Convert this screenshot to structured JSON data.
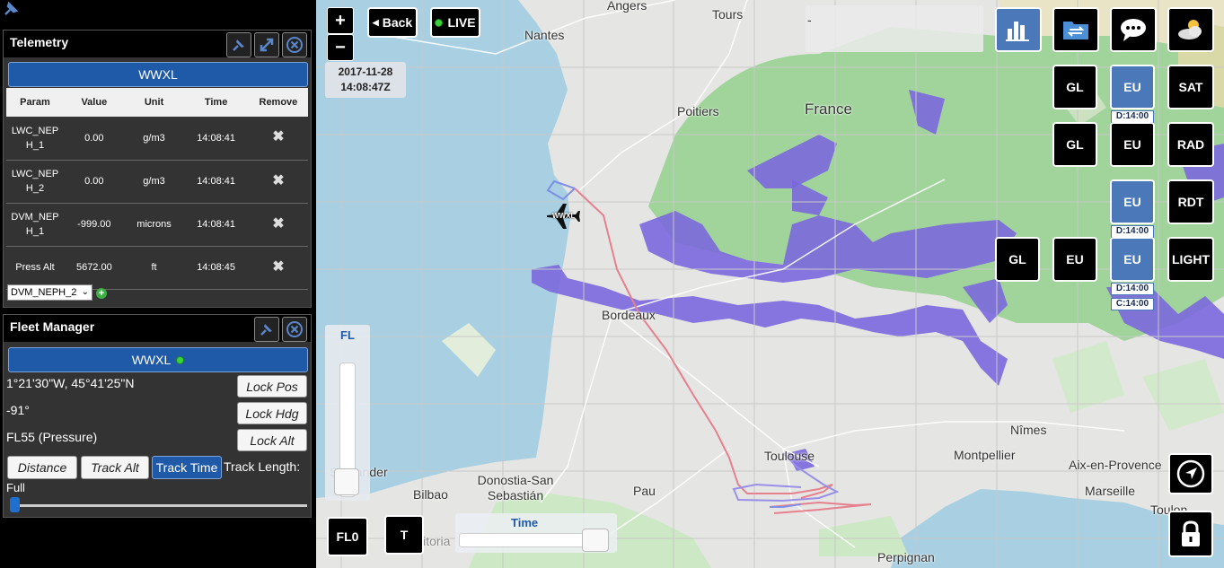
{
  "telemetry": {
    "title": "Telemetry",
    "registration": "WWXL",
    "columns": [
      "Param",
      "Value",
      "Unit",
      "Time",
      "Remove"
    ],
    "rows": [
      {
        "param": "LWC_NEPH_1",
        "value": "0.00",
        "unit": "g/m3",
        "time": "14:08:41",
        "remove": "✖"
      },
      {
        "param": "LWC_NEPH_2",
        "value": "0.00",
        "unit": "g/m3",
        "time": "14:08:41",
        "remove": "✖"
      },
      {
        "param": "DVM_NEPH_1",
        "value": "-999.00",
        "unit": "microns",
        "time": "14:08:41",
        "remove": "✖"
      },
      {
        "param": "Press Alt",
        "value": "5672.00",
        "unit": "ft",
        "time": "14:08:45",
        "remove": "✖"
      }
    ],
    "select_value": "DVM_NEPH_2"
  },
  "fleet": {
    "title": "Fleet Manager",
    "registration": "WWXL",
    "position": "1°21'30\"W, 45°41'25\"N",
    "heading": "-91°",
    "altitude": "FL55 (Pressure)",
    "lock_pos": "Lock Pos",
    "lock_hdg": "Lock Hdg",
    "lock_alt": "Lock Alt",
    "btn_distance": "Distance",
    "btn_track_alt": "Track Alt",
    "btn_track_time": "Track Time",
    "track_length_label": "Track Length:",
    "track_length_value": "Full",
    "track_length_fraction": 0.0
  },
  "map": {
    "zoom_in": "+",
    "zoom_out": "−",
    "back": "Back",
    "live": "LIVE",
    "date": "2017-11-28",
    "time": "14:08:47Z",
    "search_value": "-",
    "aircraft_label": "WWXL",
    "cities": {
      "angers": "Angers",
      "tours": "Tours",
      "nantes": "Nantes",
      "poitiers": "Poitiers",
      "france": "France",
      "bordeaux": "Bordeaux",
      "toulouse": "Toulouse",
      "nimes": "Nîmes",
      "montpellier": "Montpellier",
      "aix": "Aix-en-Provence",
      "marseille": "Marseille",
      "toulon": "Toulon",
      "santander": "Santander",
      "bilbao": "Bilbao",
      "donostia": "Donostia-San Sebastián",
      "pau": "Pau",
      "perpignan": "Perpignan",
      "vitoria": "Vitoria"
    },
    "layers": {
      "row1": {
        "gl": "GL",
        "eu": "EU",
        "eu_sub": "D:14:00",
        "sat": "SAT"
      },
      "row2": {
        "gl": "GL",
        "eu": "EU",
        "rad": "RAD"
      },
      "row3": {
        "eu": "EU",
        "eu_sub": "D:14:00",
        "rdt": "RDT"
      },
      "row4": {
        "gl": "GL",
        "eu": "EU",
        "eu2": "EU",
        "eu2_sub1": "D:14:00",
        "eu2_sub2": "C:14:00",
        "light": "LIGHT"
      }
    },
    "fl_label": "FL",
    "fl_level_fraction": 0.0,
    "fl_button": "FL0",
    "t_button": "T",
    "time_label": "Time",
    "time_fraction": 1.0
  },
  "icons": [
    "pin-icon",
    "expand-icon",
    "close-icon",
    "bar-chart-icon",
    "folder-transfer-icon",
    "chat-icon",
    "weather-icon",
    "navigate-icon",
    "lock-icon",
    "aircraft-icon"
  ],
  "colors": {
    "accent_blue": "#1f5aa8",
    "layer_blue": "#4a78b8",
    "sea": "#a6cfe0",
    "cloud_green": "#9fd49a",
    "precip_purple": "#7d6bdc",
    "track_red": "#e7808e",
    "track_blue": "#7e8fe8"
  }
}
